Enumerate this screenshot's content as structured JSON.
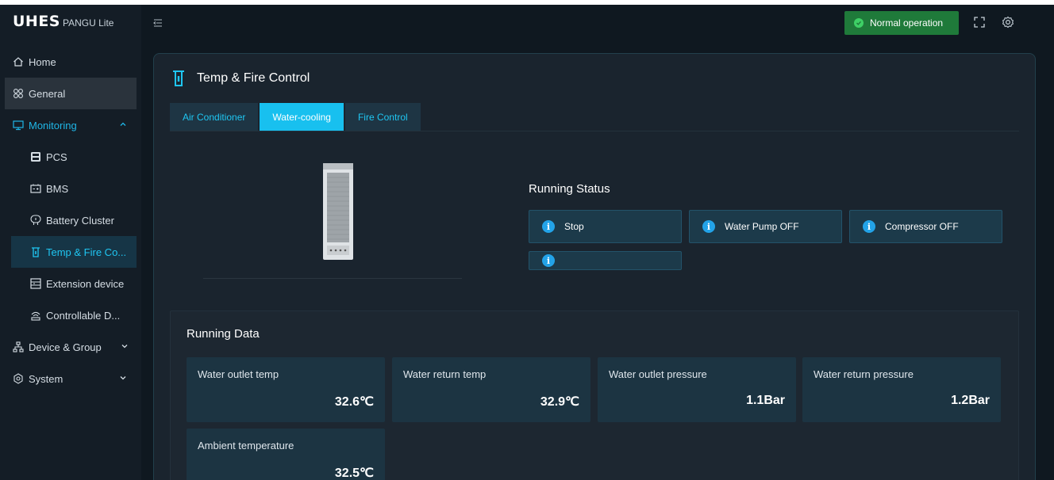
{
  "app": {
    "logo_main": "UHES",
    "logo_sub": "PANGU Lite"
  },
  "header": {
    "status_label": "Normal operation",
    "status_color": "#1f7a3a",
    "menu_icon": "menu-fold-icon",
    "fullscreen_icon": "fullscreen-icon",
    "settings_icon": "gear-icon"
  },
  "sidebar": {
    "items": [
      {
        "label": "Home",
        "icon": "home-icon"
      },
      {
        "label": "General",
        "icon": "grid-icon"
      },
      {
        "label": "Monitoring",
        "icon": "monitor-icon"
      },
      {
        "label": "PCS",
        "icon": "pcs-icon"
      },
      {
        "label": "BMS",
        "icon": "battery-icon"
      },
      {
        "label": "Battery Cluster",
        "icon": "cluster-icon"
      },
      {
        "label": "Temp & Fire Co...",
        "icon": "thermometer-icon"
      },
      {
        "label": "Extension device",
        "icon": "extension-icon"
      },
      {
        "label": "Controllable D...",
        "icon": "controllable-icon"
      },
      {
        "label": "Device & Group",
        "icon": "device-group-icon"
      },
      {
        "label": "System",
        "icon": "system-gear-icon"
      }
    ]
  },
  "panel": {
    "title": "Temp & Fire Control",
    "tabs": [
      {
        "label": "Air Conditioner"
      },
      {
        "label": "Water-cooling"
      },
      {
        "label": "Fire Control"
      }
    ],
    "active_tab": "Water-cooling"
  },
  "running_status": {
    "title": "Running Status",
    "items": [
      {
        "label": "Stop"
      },
      {
        "label": "Water Pump OFF"
      },
      {
        "label": "Compressor OFF"
      },
      {
        "label": ""
      }
    ]
  },
  "running_data": {
    "title": "Running Data",
    "cards": [
      {
        "label": "Water outlet temp",
        "value": "32.6℃"
      },
      {
        "label": "Water return temp",
        "value": "32.9℃"
      },
      {
        "label": "Water outlet pressure",
        "value": "1.1Bar"
      },
      {
        "label": "Water return pressure",
        "value": "1.2Bar"
      },
      {
        "label": "Ambient temperature",
        "value": "32.5℃"
      }
    ]
  },
  "colors": {
    "accent": "#18c0ef",
    "background": "#0f1820",
    "panel": "#1a242e",
    "card": "#1c3442"
  }
}
